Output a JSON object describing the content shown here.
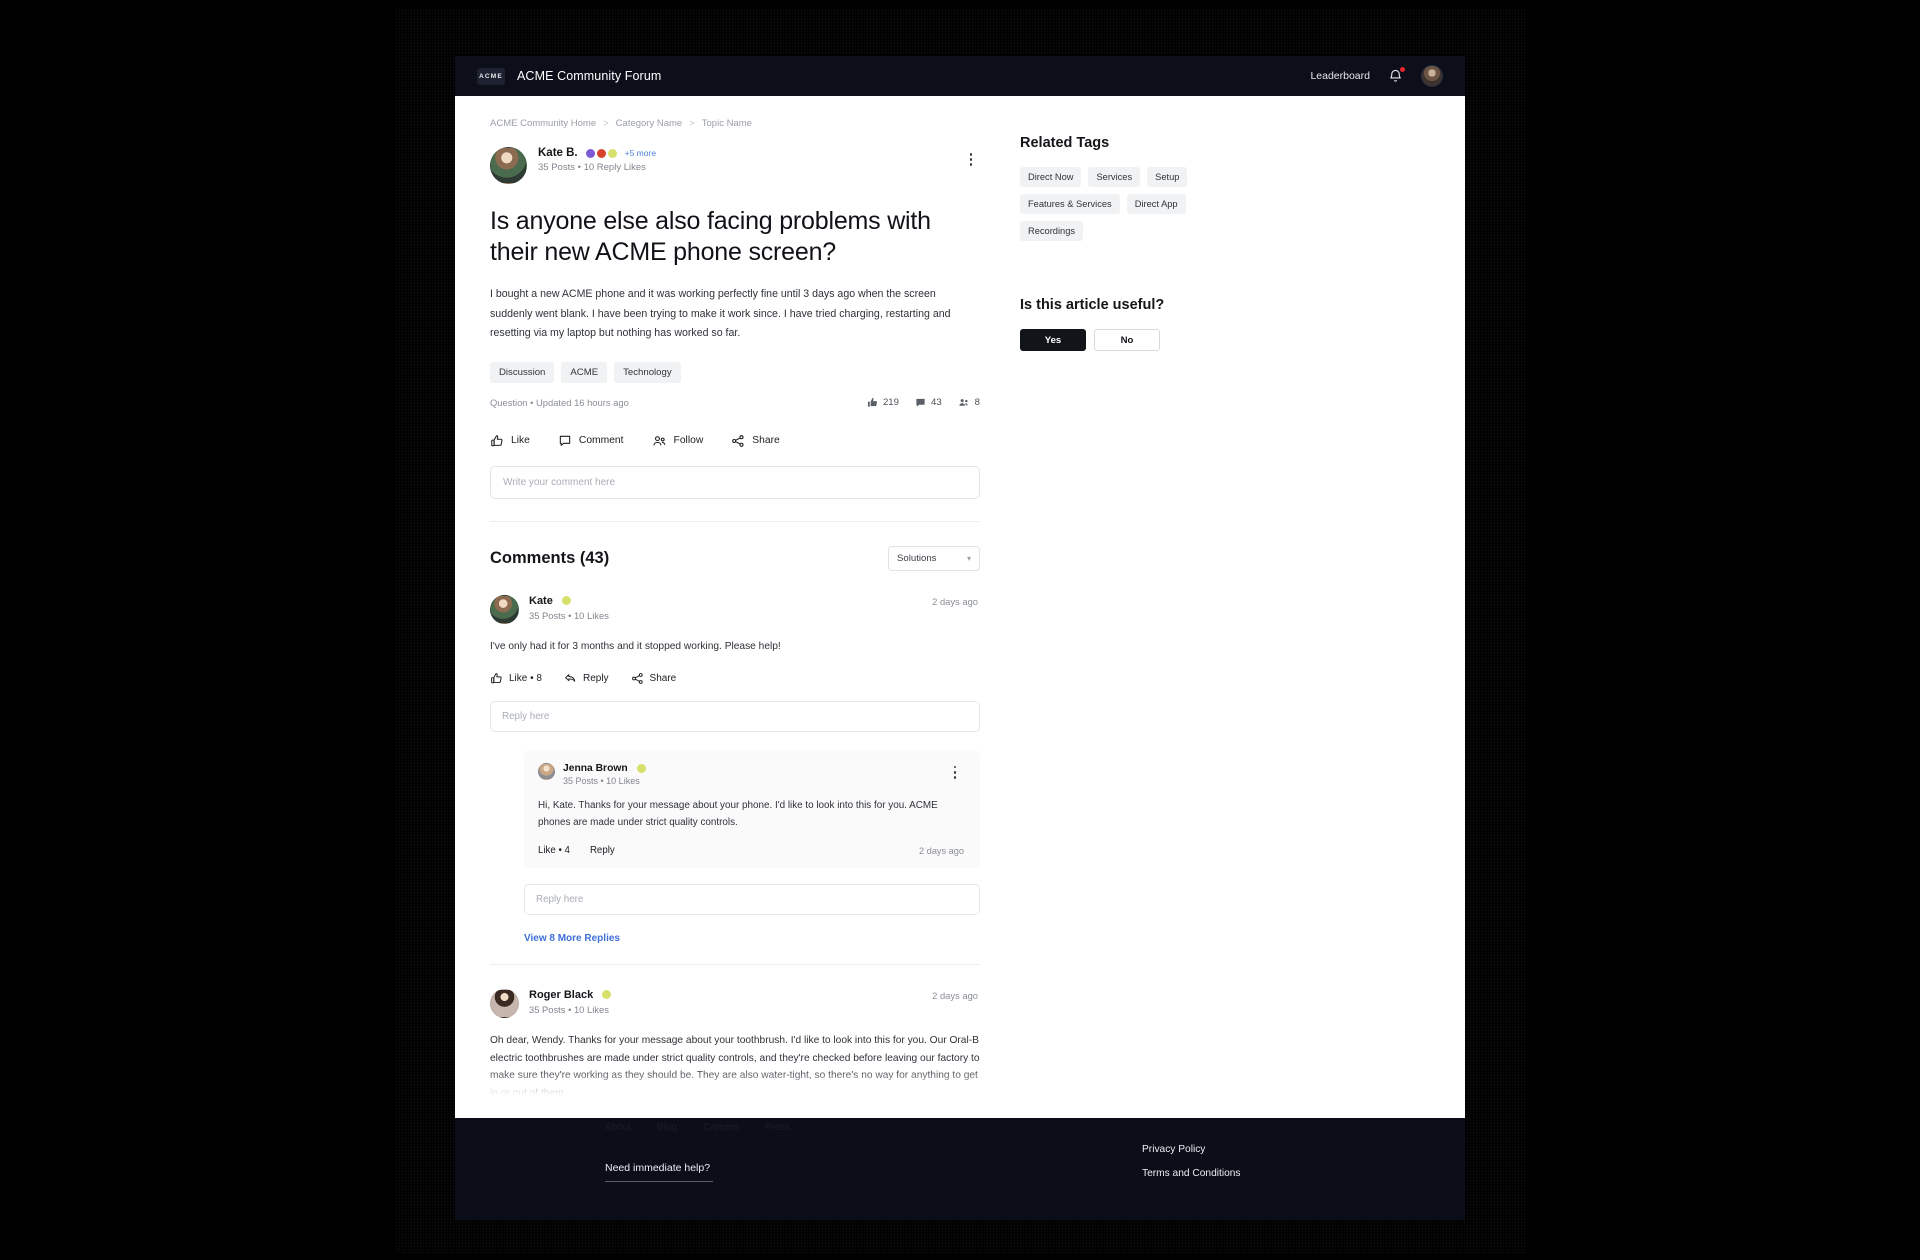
{
  "topnav": {
    "brand_mark": "ACME",
    "title": "ACME Community Forum",
    "leaderboard": "Leaderboard",
    "bell_icon": "bell-icon",
    "avatar_icon": "user-avatar"
  },
  "breadcrumb": {
    "items": [
      "ACME Community Home",
      "Category Name",
      "Topic Name"
    ],
    "separator": ">"
  },
  "post": {
    "author": {
      "name": "Kate B.",
      "badges_more": "+5 more",
      "stats": "35 Posts  •  10 Reply Likes"
    },
    "title": "Is anyone else also facing problems with their new ACME phone screen?",
    "body": "I bought a new ACME phone and it was working perfectly fine until 3 days ago when the screen suddenly went blank. I have been trying to make it work since. I have tried charging, restarting and resetting via my laptop but nothing has worked so far.",
    "tags": [
      "Discussion",
      "ACME",
      "Technology"
    ],
    "meta": "Question • Updated 16 hours ago",
    "stats": {
      "likes": "219",
      "comments": "43",
      "followers": "8"
    },
    "actions": [
      {
        "label": "Like",
        "icon": "thumbs-up-icon"
      },
      {
        "label": "Comment",
        "icon": "comment-bubble-icon"
      },
      {
        "label": "Follow",
        "icon": "people-icon"
      },
      {
        "label": "Share",
        "icon": "share-nodes-icon"
      }
    ],
    "comment_placeholder": "Write your comment here"
  },
  "comments_section": {
    "title": "Comments (43)",
    "sort_value": "Solutions",
    "sort_chevron": "chevron-down-icon"
  },
  "comments": [
    {
      "name": "Kate",
      "stats": "35 Posts  •  10 Likes",
      "time": "2 days ago",
      "body": "I've only had it for 3 months and it stopped working. Please help!",
      "actions": [
        {
          "label": "Like • 8",
          "icon": "thumbs-up-icon"
        },
        {
          "label": "Reply",
          "icon": "reply-arrow-icon"
        },
        {
          "label": "Share",
          "icon": "share-nodes-icon"
        }
      ],
      "reply_placeholder": "Reply here",
      "nested": {
        "name": "Jenna Brown",
        "stats": "35 Posts  •  10 Likes",
        "body": "Hi, Kate. Thanks for your message about your phone. I'd like to look into this for you. ACME phones are made under strict quality controls.",
        "actions": [
          "Like • 4",
          "Reply"
        ],
        "time": "2 days ago"
      },
      "nested_reply_placeholder": "Reply here",
      "view_more": "View 8 More Replies"
    },
    {
      "name": "Roger Black",
      "stats": "35 Posts  •  10 Likes",
      "time": "2 days ago",
      "body": "Oh dear, Wendy. Thanks for your message about your toothbrush. I'd like to look into this for you. Our Oral-B electric toothbrushes are made under strict quality controls, and they're checked before leaving our factory to make sure they're working as they should be. They are also water-tight, so there's no way for anything to get in or out of them."
    }
  ],
  "sidebar": {
    "related_tags_title": "Related Tags",
    "tags": [
      "Direct Now",
      "Services",
      "Setup",
      "Features & Services",
      "Direct App",
      "Recordings"
    ],
    "useful_title": "Is this article useful?",
    "yes_label": "Yes",
    "no_label": "No"
  },
  "footer": {
    "help": "Need immediate help?",
    "links": [
      "Privacy Policy",
      "Terms and Conditions"
    ],
    "faint": [
      "About",
      "Blog",
      "Careers",
      "Press"
    ]
  },
  "colors": {
    "nav_bg": "#0c0f1a",
    "footer_bg": "#0b0e18",
    "link_blue": "#3f6fd8",
    "badge_red": "#e8242d",
    "chip_bg": "#f1f2f4"
  }
}
